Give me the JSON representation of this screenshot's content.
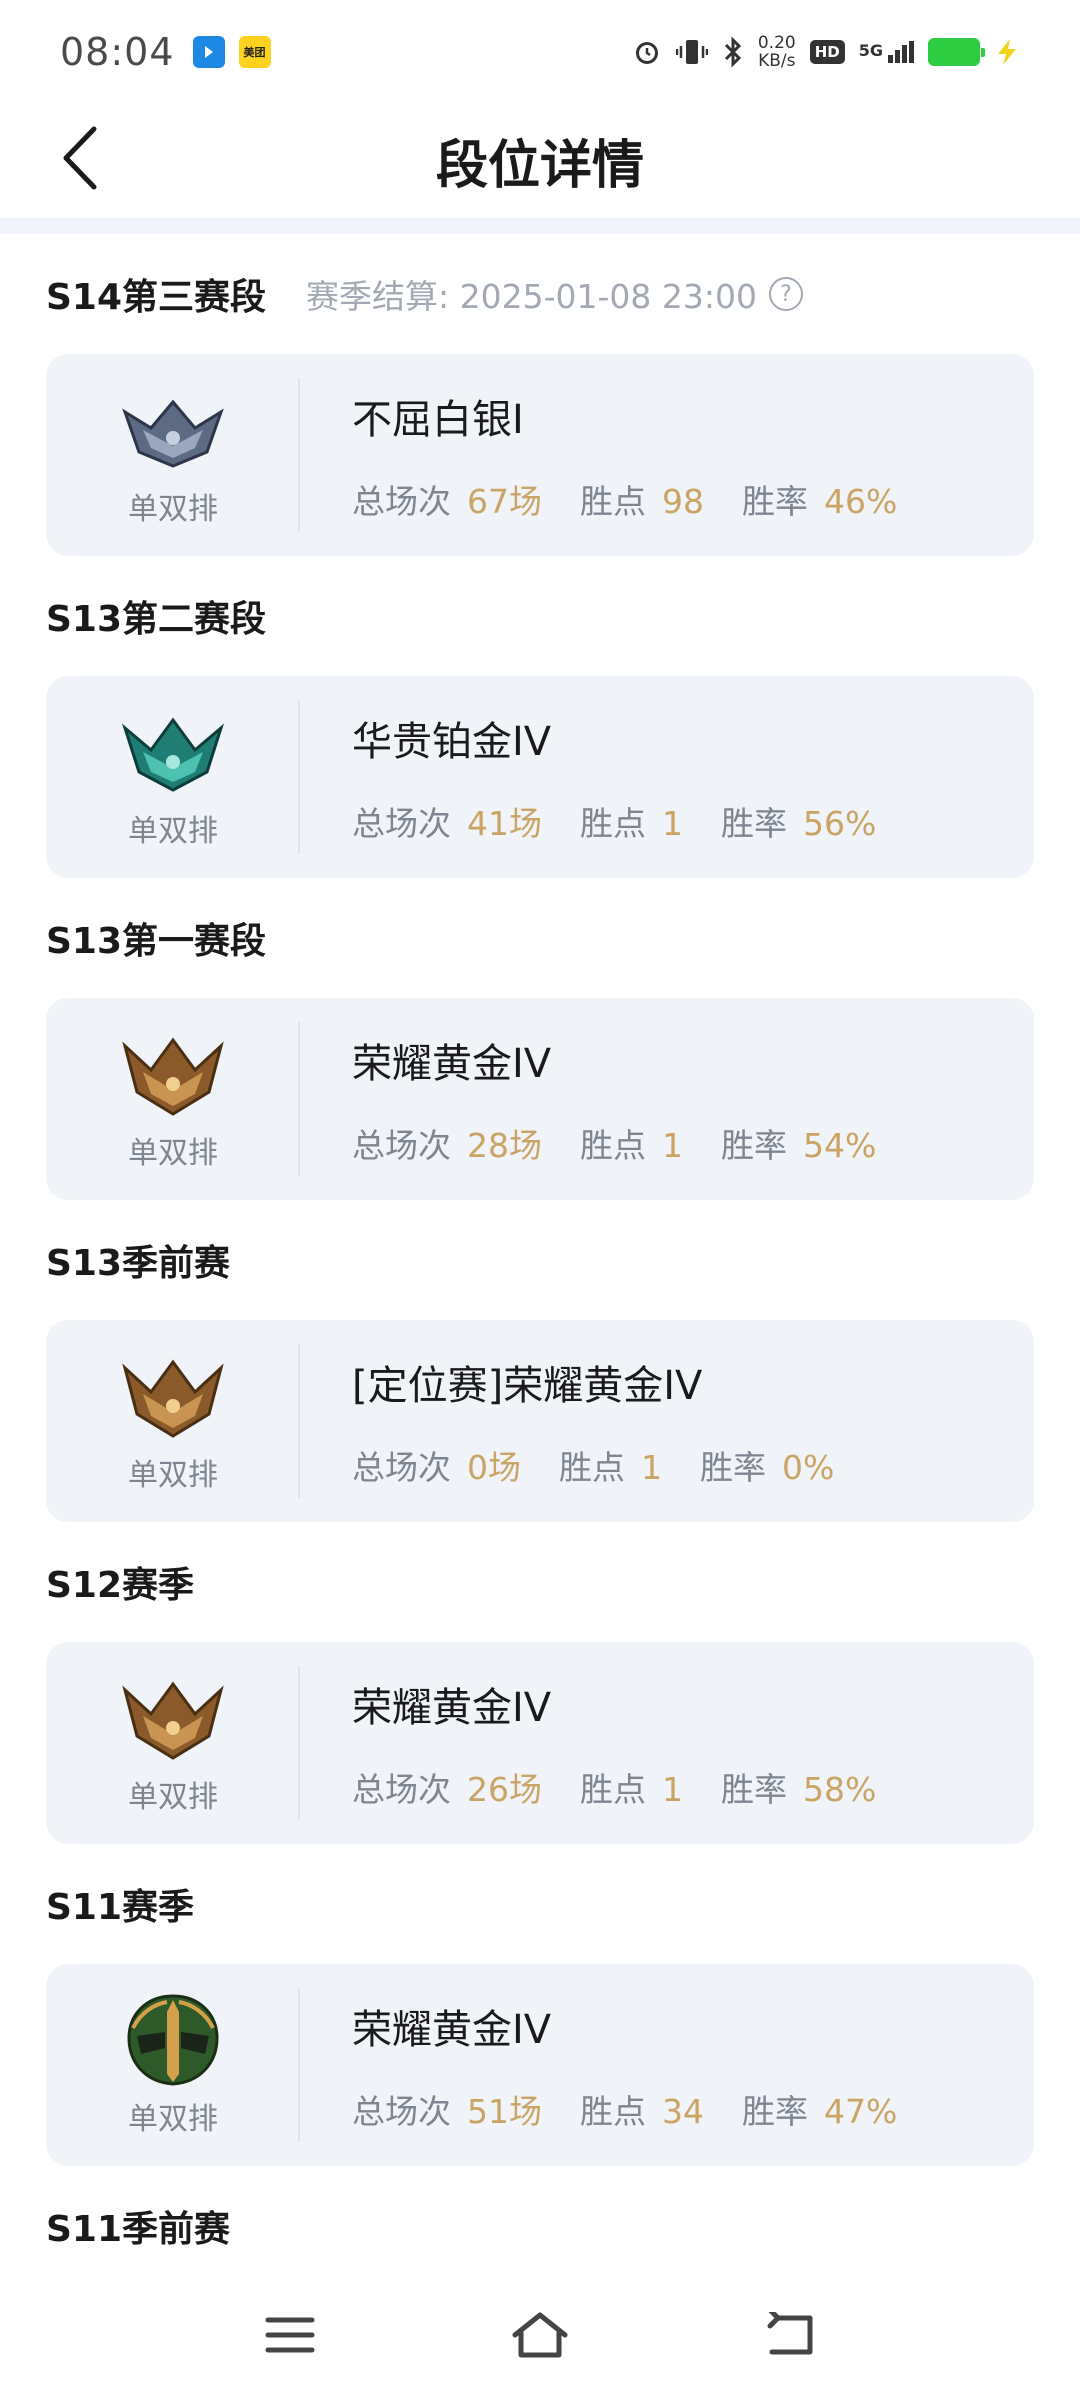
{
  "status_bar": {
    "time": "08:04",
    "app_icons": [
      "blue-app-icon",
      "meituan-icon"
    ],
    "meituan_label": "美团",
    "net_speed": "0.20",
    "net_unit": "KB/s",
    "hd": "HD",
    "network": "5G",
    "battery_color": "#2ecc40"
  },
  "header": {
    "title": "段位详情",
    "back_icon": "chevron-left-icon"
  },
  "seasons": [
    {
      "name": "S14第三赛段",
      "settle": "赛季结算: 2025-01-08 23:00",
      "rank": "不屈白银I",
      "queue": "单双排",
      "emblem": "silver",
      "games_label": "总场次",
      "games": "67场",
      "lp_label": "胜点",
      "lp": "98",
      "winrate_label": "胜率",
      "winrate": "46%"
    },
    {
      "name": "S13第二赛段",
      "rank": "华贵铂金IV",
      "queue": "单双排",
      "emblem": "platinum",
      "games_label": "总场次",
      "games": "41场",
      "lp_label": "胜点",
      "lp": "1",
      "winrate_label": "胜率",
      "winrate": "56%"
    },
    {
      "name": "S13第一赛段",
      "rank": "荣耀黄金IV",
      "queue": "单双排",
      "emblem": "gold",
      "games_label": "总场次",
      "games": "28场",
      "lp_label": "胜点",
      "lp": "1",
      "winrate_label": "胜率",
      "winrate": "54%"
    },
    {
      "name": "S13季前赛",
      "rank": "[定位赛]荣耀黄金IV",
      "queue": "单双排",
      "emblem": "gold",
      "games_label": "总场次",
      "games": "0场",
      "lp_label": "胜点",
      "lp": "1",
      "winrate_label": "胜率",
      "winrate": "0%"
    },
    {
      "name": "S12赛季",
      "rank": "荣耀黄金IV",
      "queue": "单双排",
      "emblem": "gold",
      "games_label": "总场次",
      "games": "26场",
      "lp_label": "胜点",
      "lp": "1",
      "winrate_label": "胜率",
      "winrate": "58%"
    },
    {
      "name": "S11赛季",
      "rank": "荣耀黄金IV",
      "queue": "单双排",
      "emblem": "gold-helmet",
      "games_label": "总场次",
      "games": "51场",
      "lp_label": "胜点",
      "lp": "34",
      "winrate_label": "胜率",
      "winrate": "47%"
    },
    {
      "name": "S11季前赛"
    }
  ],
  "colors": {
    "accent_gold": "#c9a465",
    "card_bg": "#f0f3f8",
    "muted_text": "#7e8591"
  },
  "bottom_nav": [
    "menu-icon",
    "home-icon",
    "back-icon"
  ]
}
